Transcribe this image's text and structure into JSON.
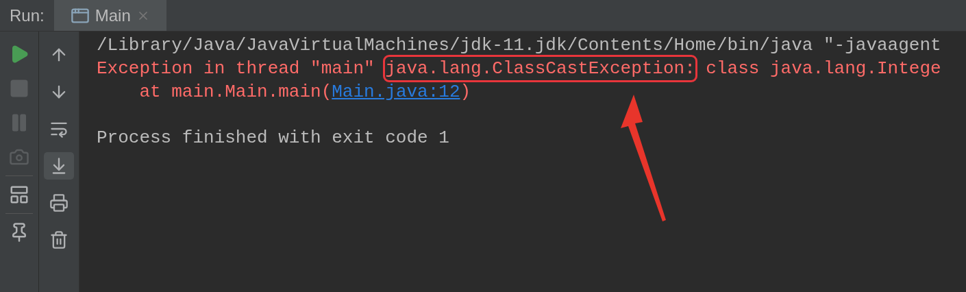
{
  "run_label": "Run:",
  "tabs": [
    {
      "label": "Main",
      "selected": true,
      "closable": true
    }
  ],
  "left_toolbar": [
    {
      "kind": "run",
      "disabled": false
    },
    {
      "kind": "stop",
      "disabled": true
    },
    {
      "kind": "pause",
      "disabled": true
    },
    {
      "kind": "camera",
      "disabled": true
    },
    {
      "kind": "separator"
    },
    {
      "kind": "layout",
      "disabled": false
    },
    {
      "kind": "separator"
    },
    {
      "kind": "pin",
      "disabled": false
    }
  ],
  "right_toolbar": [
    {
      "kind": "up",
      "selected": false
    },
    {
      "kind": "down",
      "selected": false
    },
    {
      "kind": "wrap",
      "selected": false
    },
    {
      "kind": "scroll_end",
      "selected": true
    },
    {
      "kind": "print",
      "selected": false
    },
    {
      "kind": "trash",
      "selected": false
    }
  ],
  "console": [
    {
      "kind": "output",
      "parts": [
        {
          "kind": "normal",
          "text": "/Library/Java/JavaVirtualMachines/jdk-11.jdk/Contents/Home/bin/java \"-javaagent",
          "highlighted": false
        }
      ]
    },
    {
      "kind": "output",
      "parts": [
        {
          "kind": "error",
          "text": "Exception in thread \"main\" ",
          "highlighted": false
        },
        {
          "kind": "error",
          "text": "java.lang.ClassCastException:",
          "highlighted": true
        },
        {
          "kind": "error",
          "text": " class java.lang.Intege",
          "highlighted": false
        }
      ]
    },
    {
      "kind": "output",
      "parts": [
        {
          "kind": "error",
          "text": "    at main.Main.main(",
          "highlighted": false
        },
        {
          "kind": "link",
          "text": "Main.java:12",
          "highlighted": false
        },
        {
          "kind": "error",
          "text": ")",
          "highlighted": false
        }
      ]
    },
    {
      "kind": "blank"
    },
    {
      "kind": "output",
      "parts": [
        {
          "kind": "normal",
          "text": "Process finished with exit code 1",
          "highlighted": false
        }
      ]
    }
  ],
  "annotation": {
    "kind": "arrow"
  }
}
